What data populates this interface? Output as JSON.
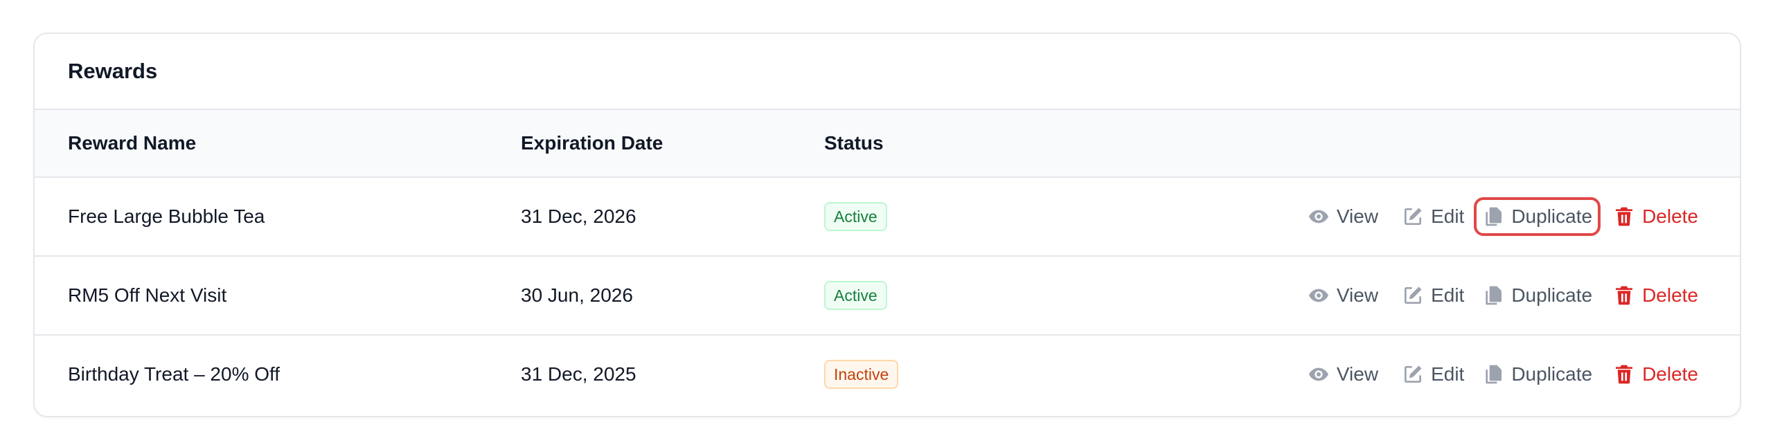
{
  "card": {
    "title": "Rewards"
  },
  "table": {
    "columns": {
      "name": "Reward Name",
      "expiration": "Expiration Date",
      "status": "Status"
    },
    "rows": [
      {
        "name": "Free Large Bubble Tea",
        "expiration": "31 Dec, 2026",
        "status": "Active",
        "status_kind": "active"
      },
      {
        "name": "RM5 Off Next Visit",
        "expiration": "30 Jun, 2026",
        "status": "Active",
        "status_kind": "active"
      },
      {
        "name": "Birthday Treat – 20% Off",
        "expiration": "31 Dec, 2025",
        "status": "Inactive",
        "status_kind": "inactive"
      }
    ],
    "actions": {
      "view": "View",
      "edit": "Edit",
      "duplicate": "Duplicate",
      "delete": "Delete"
    }
  },
  "icons": {
    "view": "eye-icon",
    "edit": "edit-icon",
    "duplicate": "copy-icon",
    "delete": "trash-icon"
  },
  "colors": {
    "active_text": "#15803d",
    "inactive_text": "#c2410c",
    "delete": "#dc2626",
    "highlight_ring": "#e04848"
  }
}
